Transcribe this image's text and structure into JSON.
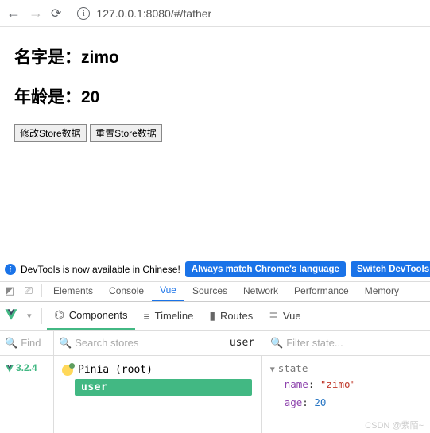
{
  "browser": {
    "url": "127.0.0.1:8080/#/father"
  },
  "page": {
    "name_label": "名字是：",
    "name_value": "zimo",
    "age_label": "年龄是：",
    "age_value": "20",
    "btn_modify": "修改Store数据",
    "btn_reset": "重置Store数据"
  },
  "notice": {
    "text": "DevTools is now available in Chinese!",
    "btn1": "Always match Chrome's language",
    "btn2": "Switch DevTools to C"
  },
  "devtools_tabs": {
    "elements": "Elements",
    "console": "Console",
    "vue": "Vue",
    "sources": "Sources",
    "network": "Network",
    "performance": "Performance",
    "memory": "Memory"
  },
  "vue_bar": {
    "components": "Components",
    "timeline": "Timeline",
    "routes": "Routes",
    "vuex": "Vue"
  },
  "filters": {
    "find": "Find",
    "search_stores": "Search stores",
    "selected": "user",
    "filter_state": "Filter state..."
  },
  "left": {
    "version": "3.2.4"
  },
  "tree": {
    "root": "Pinia (root)",
    "store": "user"
  },
  "state": {
    "header": "state",
    "name_key": "name",
    "name_val": "\"zimo\"",
    "age_key": "age",
    "age_val": "20"
  },
  "watermark": "CSDN @紫陌~"
}
